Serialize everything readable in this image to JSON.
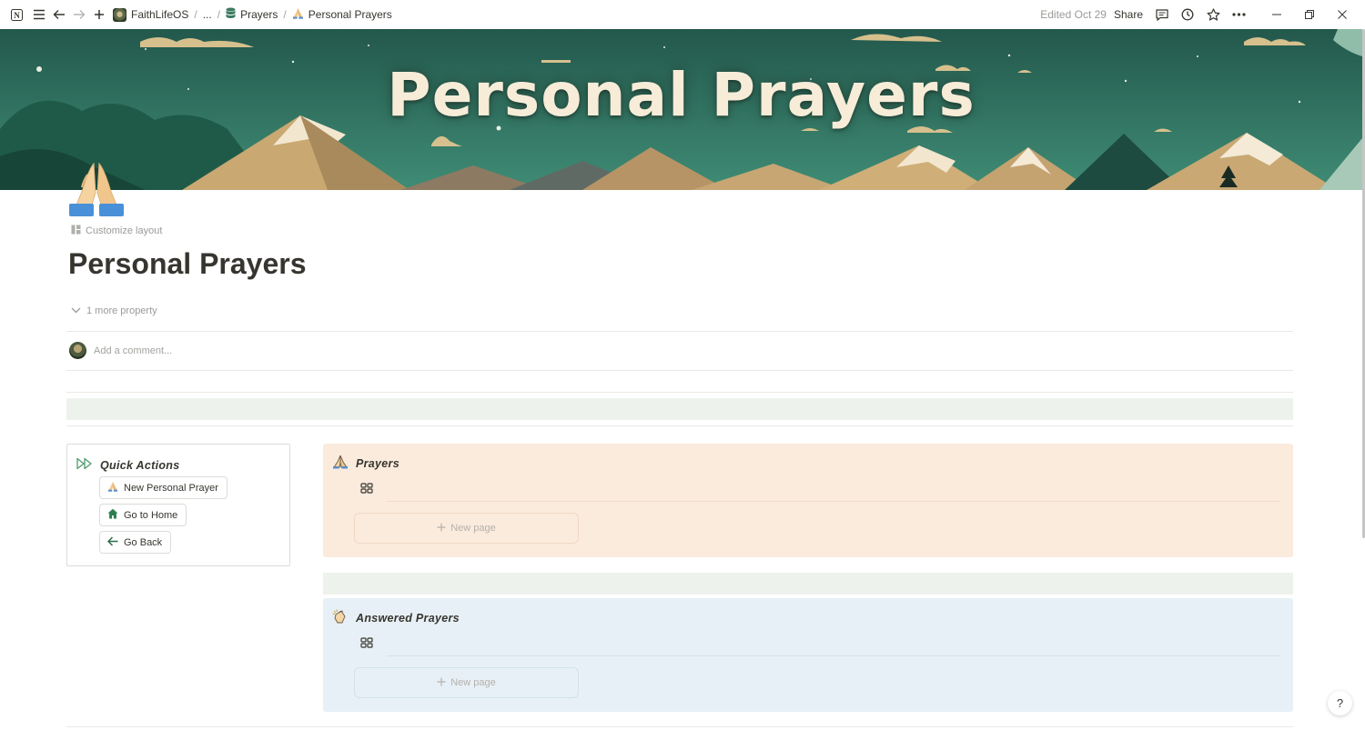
{
  "topbar": {
    "breadcrumb": [
      {
        "label": "FaithLifeOS"
      },
      {
        "label": "..."
      },
      {
        "label": "Prayers"
      },
      {
        "label": "Personal Prayers"
      }
    ],
    "separator": "/",
    "edited": "Edited Oct 29",
    "share": "Share",
    "icons": [
      "notion-logo-icon",
      "sidebar-menu-icon",
      "back-arrow-icon",
      "forward-arrow-icon",
      "new-page-plus-icon",
      "comments-icon",
      "history-clock-icon",
      "favorite-star-icon",
      "more-dots-icon",
      "minimize-icon",
      "restore-icon",
      "close-icon"
    ]
  },
  "cover": {
    "title": "Personal Prayers",
    "colors": {
      "sky": "#2f6e5f",
      "mountain": "#c8a572",
      "snow": "#f4ead6"
    }
  },
  "page": {
    "icon": "folded-hands-emoji",
    "customize_layout": "Customize layout",
    "title": "Personal Prayers",
    "more_property": "1 more property",
    "comment_placeholder": "Add a comment..."
  },
  "quick_actions": {
    "heading": "Quick Actions",
    "buttons": [
      {
        "label": "New Personal Prayer",
        "icon": "folded-hands-icon"
      },
      {
        "label": "Go to Home",
        "icon": "house-icon"
      },
      {
        "label": "Go Back",
        "icon": "arrow-left-icon"
      }
    ]
  },
  "databases": [
    {
      "title": "Prayers",
      "icon": "praying-hands-icon",
      "view_icon": "gallery-view-icon",
      "new_page": "New page",
      "bg": "#fbebdd"
    },
    {
      "title": "Answered Prayers",
      "icon": "clapping-hands-icon",
      "view_icon": "gallery-view-icon",
      "new_page": "New page",
      "bg": "#e7f0f6"
    }
  ],
  "colors": {
    "divider_band": "#edf3ec",
    "text": "#37352f",
    "muted": "#9b9a97"
  },
  "help_button": "?"
}
